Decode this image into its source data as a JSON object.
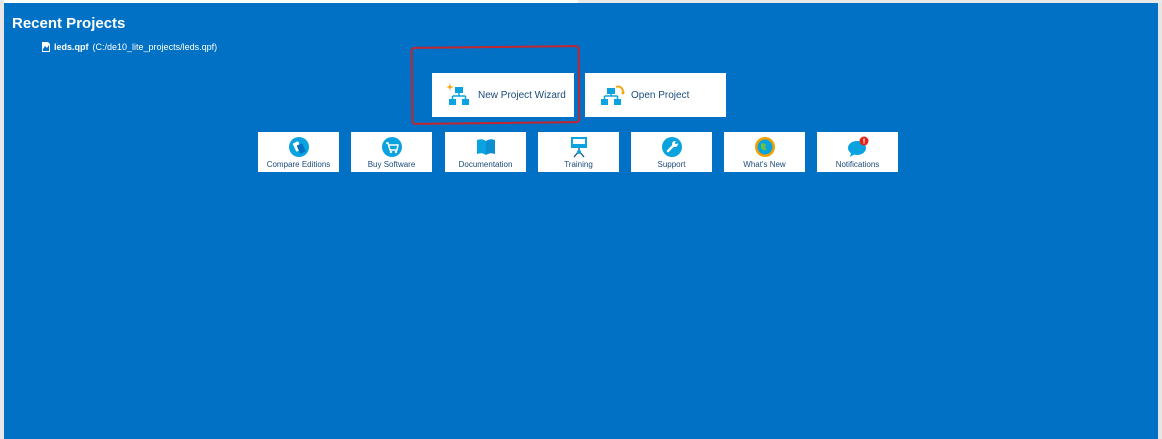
{
  "recent_projects": {
    "heading": "Recent Projects",
    "items": [
      {
        "name": "leds.qpf",
        "path": "(C:/de10_lite_projects/leds.qpf)"
      }
    ]
  },
  "actions": {
    "new_project_label": "New Project Wizard",
    "open_project_label": "Open Project"
  },
  "tiles": [
    {
      "label": "Compare Editions",
      "icon": "compare-editions-icon"
    },
    {
      "label": "Buy Software",
      "icon": "cart-icon"
    },
    {
      "label": "Documentation",
      "icon": "book-icon"
    },
    {
      "label": "Training",
      "icon": "training-icon"
    },
    {
      "label": "Support",
      "icon": "wrench-icon"
    },
    {
      "label": "What's New",
      "icon": "globe-icon"
    },
    {
      "label": "Notifications",
      "icon": "notification-icon"
    }
  ],
  "colors": {
    "background": "#0071c5",
    "icon_blue": "#0aa3e0",
    "accent_orange": "#f3a100",
    "annotation_red": "#c3262e"
  }
}
